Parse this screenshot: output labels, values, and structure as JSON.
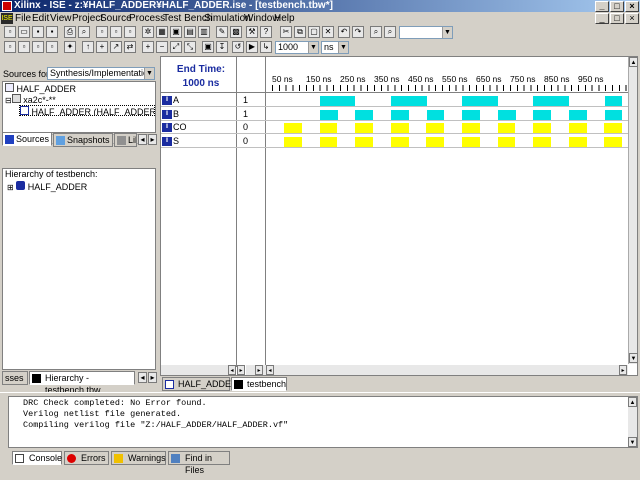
{
  "window": {
    "title": "Xilinx - ISE - z:¥HALF_ADDER¥HALF_ADDER.ise - [testbench.tbw*]"
  },
  "menu": [
    "File",
    "Edit",
    "View",
    "Project",
    "Source",
    "Process",
    "Test Bench",
    "Simulation",
    "Window",
    "Help"
  ],
  "toolbar": {
    "zoom_value": "1000",
    "unit": "ns"
  },
  "sources": {
    "label": "Sources for:",
    "view_select": "Synthesis/Implementation",
    "tree": [
      {
        "label": "HALF_ADDER",
        "level": 0
      },
      {
        "label": "xa2c*-**",
        "level": 0
      },
      {
        "label": "HALF_ADDER (HALF_ADDER.sch)",
        "level": 1
      }
    ],
    "tabs": [
      "Sources",
      "Snapshots",
      "Lib"
    ]
  },
  "hierarchy": {
    "title": "Hierarchy of testbench:",
    "tree": [
      {
        "label": "HALF_ADDER"
      }
    ]
  },
  "left_bottom_tabs": [
    "sses",
    "Hierarchy - testbench.tbw"
  ],
  "waveform": {
    "end_time_label": "End Time:",
    "end_time_value": "1000 ns",
    "time_ticks": [
      "50 ns",
      "150 ns",
      "250 ns",
      "350 ns",
      "450 ns",
      "550 ns",
      "650 ns",
      "750 ns",
      "850 ns",
      "950 ns"
    ],
    "signals": [
      {
        "name": "A",
        "value": "1"
      },
      {
        "name": "B",
        "value": "1"
      },
      {
        "name": "CO",
        "value": "0"
      },
      {
        "name": "S",
        "value": "0"
      }
    ],
    "input_color": "#00e0e0",
    "output_color": "#ffff00"
  },
  "editor_tabs": [
    "HALF_ADDER",
    "testbench"
  ],
  "console": {
    "lines": [
      "DRC Check completed: No Error found.",
      "Verilog netlist file generated.",
      "Compiling verilog file \"Z:/HALF_ADDER/HALF_ADDER.vf\""
    ],
    "tabs": [
      "Console",
      "Errors",
      "Warnings",
      "Find in Files"
    ]
  }
}
